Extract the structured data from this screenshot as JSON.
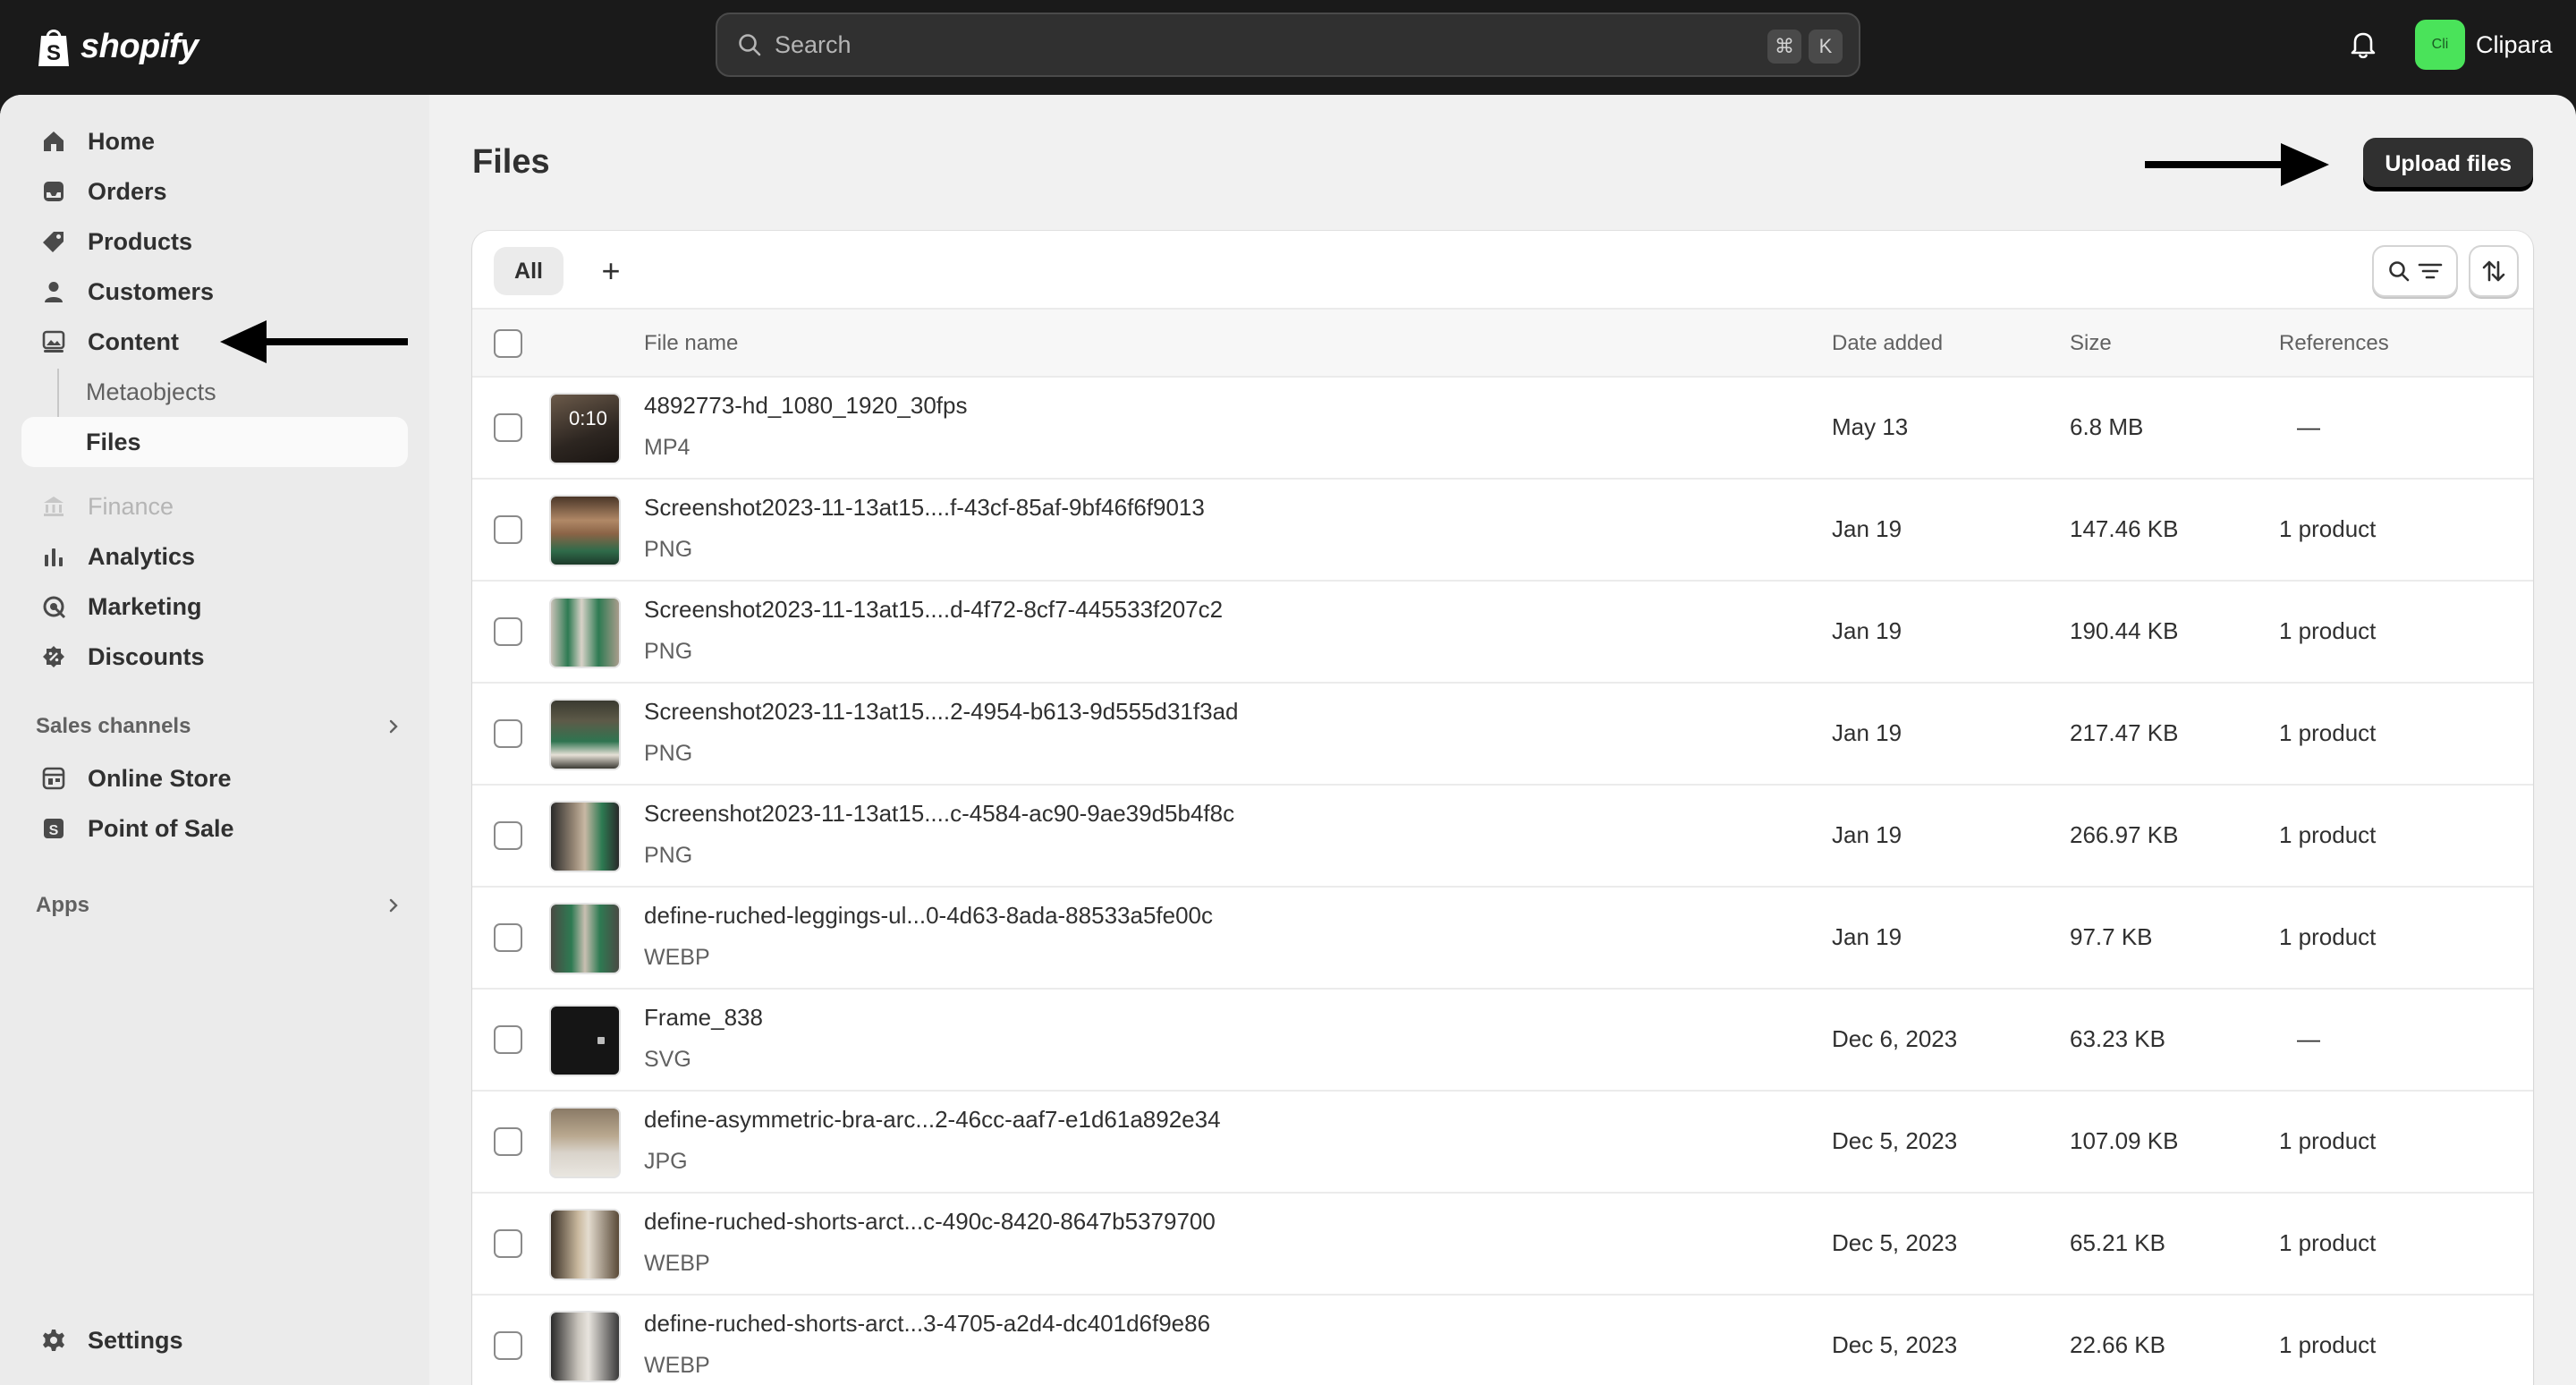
{
  "topbar": {
    "brand": "shopify",
    "search_placeholder": "Search",
    "shortcut_cmd": "⌘",
    "shortcut_key": "K",
    "store_initials": "Cli",
    "store_name": "Clipara"
  },
  "sidebar": {
    "items": [
      {
        "label": "Home",
        "icon": "home-icon"
      },
      {
        "label": "Orders",
        "icon": "inbox-icon"
      },
      {
        "label": "Products",
        "icon": "tag-icon"
      },
      {
        "label": "Customers",
        "icon": "person-icon"
      },
      {
        "label": "Content",
        "icon": "image-content-icon"
      },
      {
        "label": "Metaobjects"
      },
      {
        "label": "Files"
      },
      {
        "label": "Finance",
        "icon": "bank-icon"
      },
      {
        "label": "Analytics",
        "icon": "bar-chart-icon"
      },
      {
        "label": "Marketing",
        "icon": "target-icon"
      },
      {
        "label": "Discounts",
        "icon": "discount-icon"
      }
    ],
    "sales_channels_label": "Sales channels",
    "channels": [
      {
        "label": "Online Store",
        "icon": "store-icon"
      },
      {
        "label": "Point of Sale",
        "icon": "pos-icon"
      }
    ],
    "apps_label": "Apps",
    "settings_label": "Settings"
  },
  "page": {
    "title": "Files",
    "upload_label": "Upload files"
  },
  "toolbar": {
    "tab_all": "All",
    "tab_add": "+"
  },
  "table": {
    "headers": {
      "name": "File name",
      "date": "Date added",
      "size": "Size",
      "refs": "References"
    },
    "rows": [
      {
        "name": "4892773-hd_1080_1920_30fps",
        "type": "MP4",
        "date": "May 13",
        "size": "6.8 MB",
        "refs": "—",
        "duration": "0:10"
      },
      {
        "name": "Screenshot2023-11-13at15....f-43cf-85af-9bf46f6f9013",
        "type": "PNG",
        "date": "Jan 19",
        "size": "147.46 KB",
        "refs": "1 product"
      },
      {
        "name": "Screenshot2023-11-13at15....d-4f72-8cf7-445533f207c2",
        "type": "PNG",
        "date": "Jan 19",
        "size": "190.44 KB",
        "refs": "1 product"
      },
      {
        "name": "Screenshot2023-11-13at15....2-4954-b613-9d555d31f3ad",
        "type": "PNG",
        "date": "Jan 19",
        "size": "217.47 KB",
        "refs": "1 product"
      },
      {
        "name": "Screenshot2023-11-13at15....c-4584-ac90-9ae39d5b4f8c",
        "type": "PNG",
        "date": "Jan 19",
        "size": "266.97 KB",
        "refs": "1 product"
      },
      {
        "name": "define-ruched-leggings-ul...0-4d63-8ada-88533a5fe00c",
        "type": "WEBP",
        "date": "Jan 19",
        "size": "97.7 KB",
        "refs": "1 product"
      },
      {
        "name": "Frame_838",
        "type": "SVG",
        "date": "Dec 6, 2023",
        "size": "63.23 KB",
        "refs": "—"
      },
      {
        "name": "define-asymmetric-bra-arc...2-46cc-aaf7-e1d61a892e34",
        "type": "JPG",
        "date": "Dec 5, 2023",
        "size": "107.09 KB",
        "refs": "1 product"
      },
      {
        "name": "define-ruched-shorts-arct...c-490c-8420-8647b5379700",
        "type": "WEBP",
        "date": "Dec 5, 2023",
        "size": "65.21 KB",
        "refs": "1 product"
      },
      {
        "name": "define-ruched-shorts-arct...3-4705-a2d4-dc401d6f9e86",
        "type": "WEBP",
        "date": "Dec 5, 2023",
        "size": "22.66 KB",
        "refs": "1 product"
      }
    ]
  },
  "colors": {
    "topbar": "#1a1a1a",
    "sidebar": "#ebebeb",
    "primary_button": "#303030",
    "avatar": "#4ae35a"
  }
}
